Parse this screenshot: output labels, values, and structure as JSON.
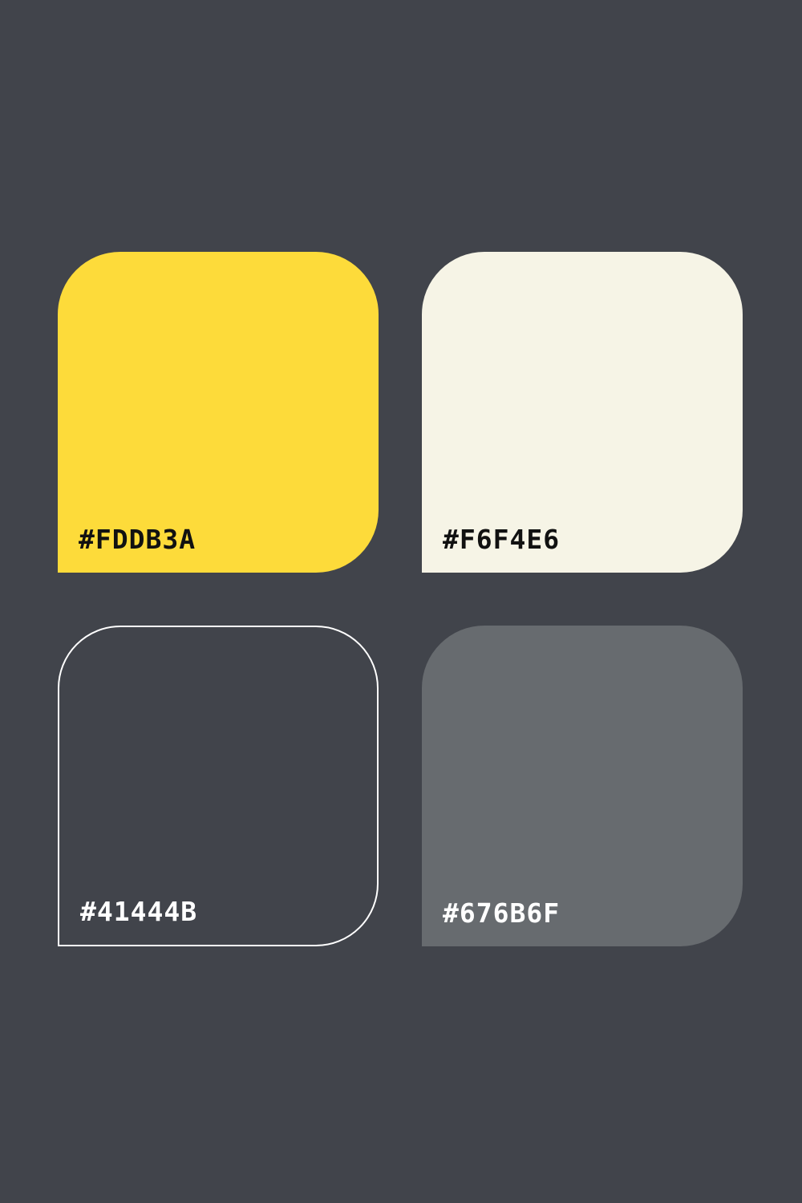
{
  "swatches": [
    {
      "hex": "#FDDB3A",
      "color": "#FDDB3A",
      "text_color": "#111111"
    },
    {
      "hex": "#F6F4E6",
      "color": "#F6F4E6",
      "text_color": "#111111"
    },
    {
      "hex": "#41444B",
      "color": "#41444B",
      "text_color": "#FFFFFF"
    },
    {
      "hex": "#676B6F",
      "color": "#676B6F",
      "text_color": "#FFFFFF"
    }
  ],
  "background": "#41444B"
}
